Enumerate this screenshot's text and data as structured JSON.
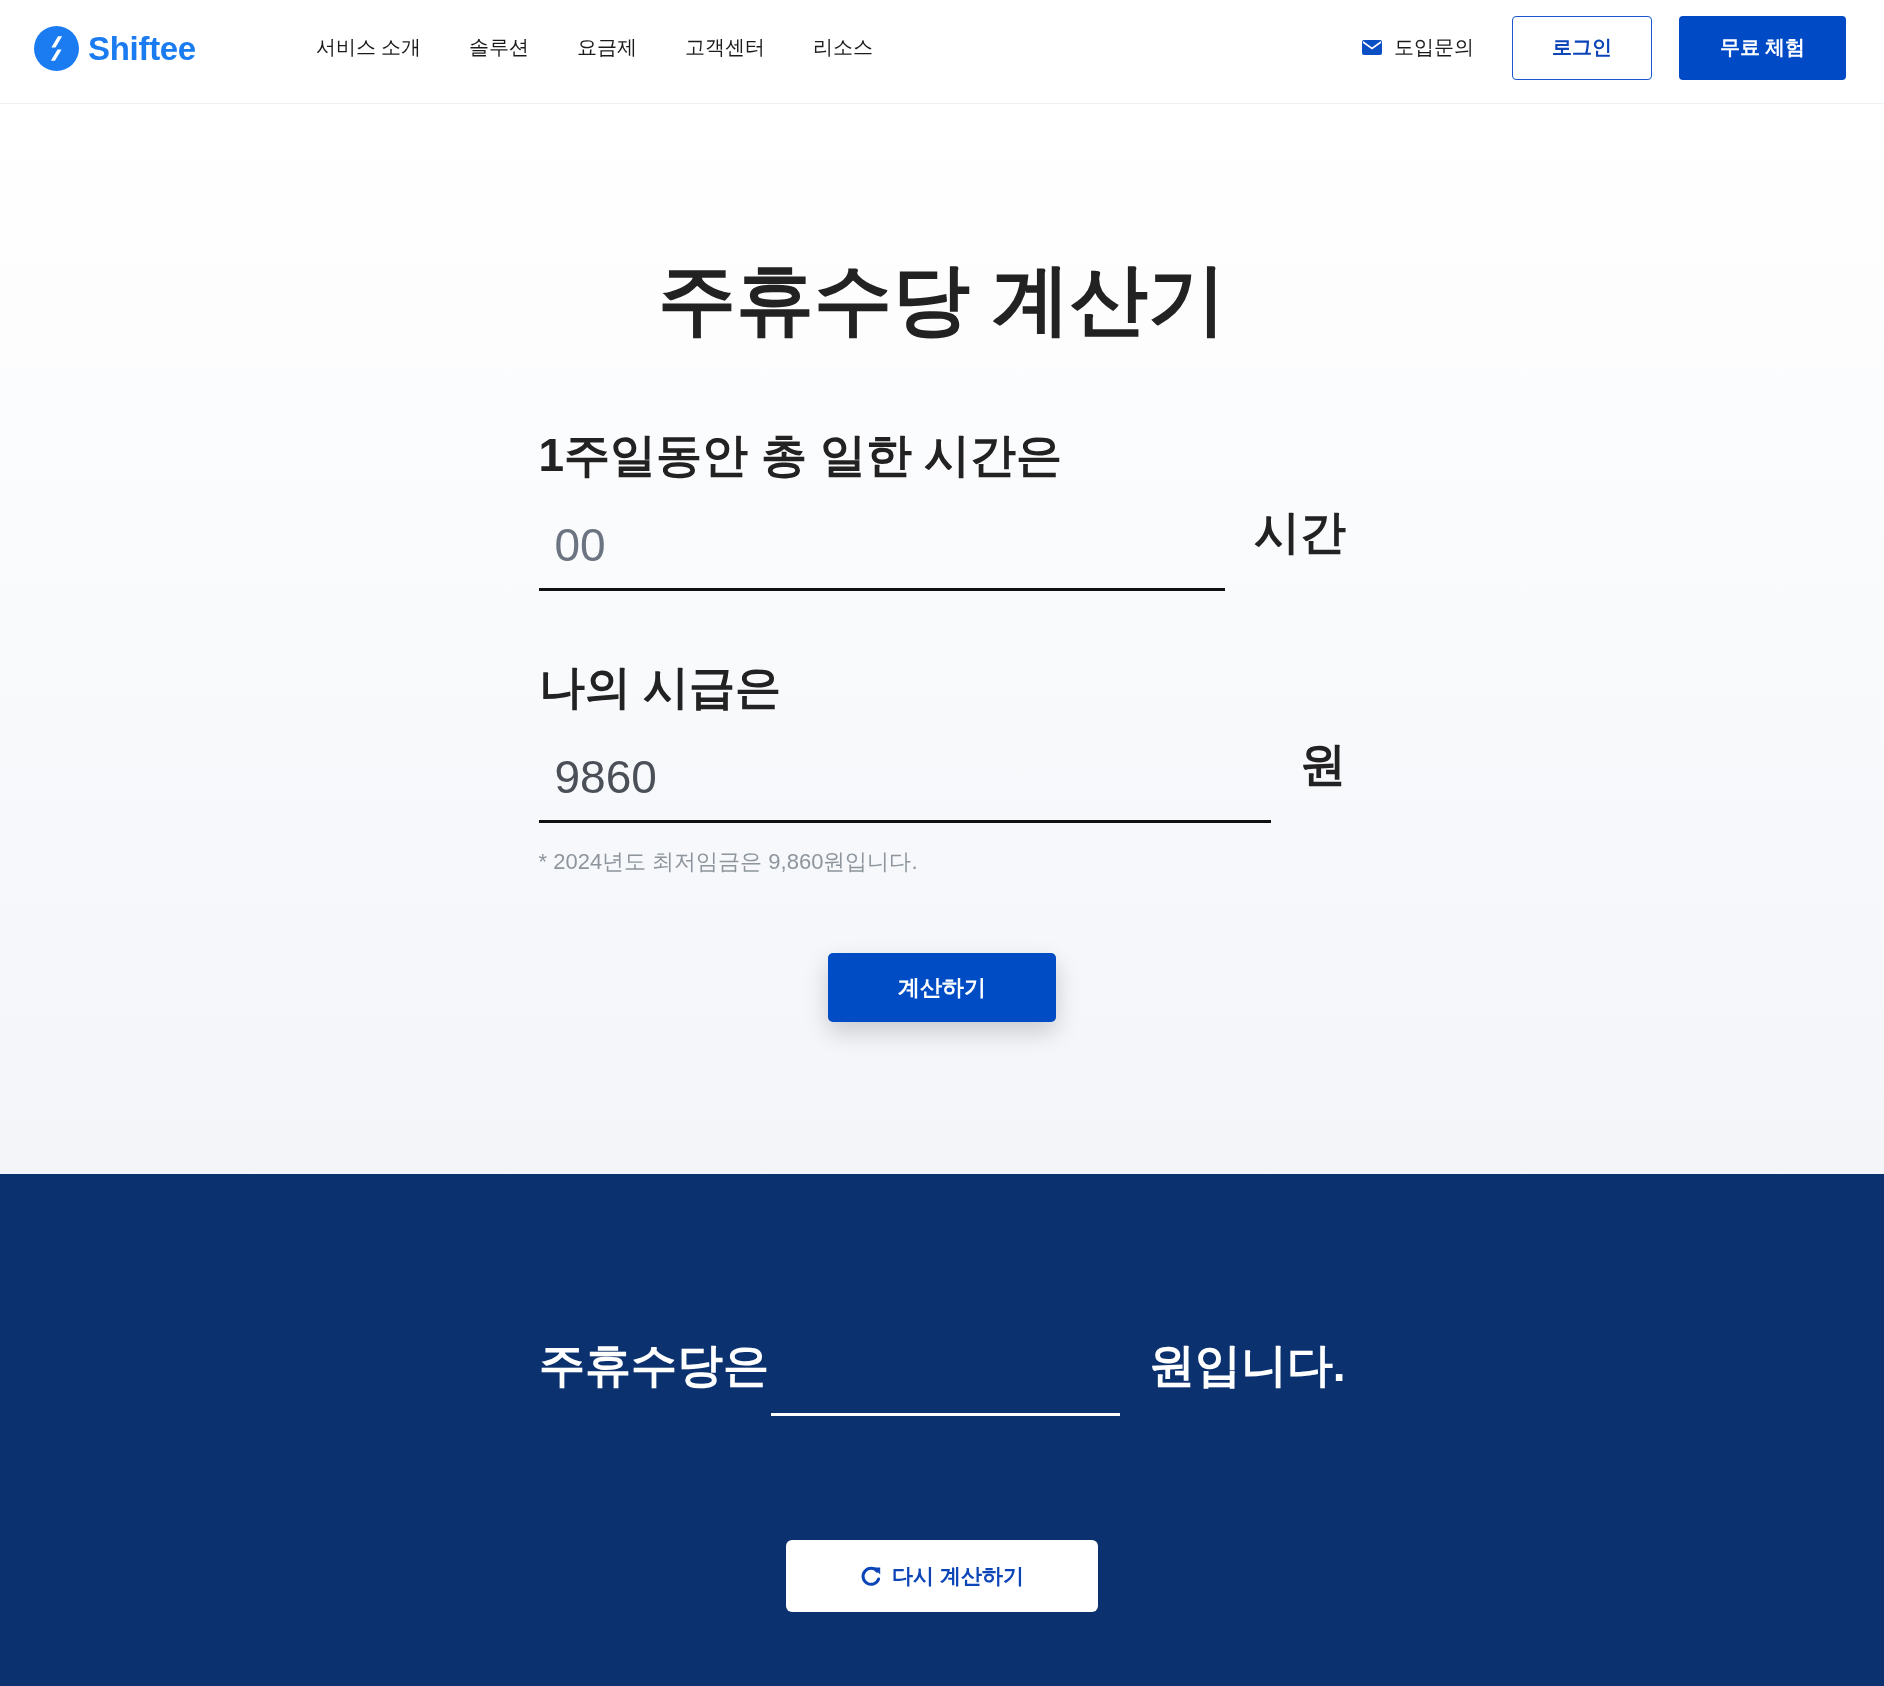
{
  "header": {
    "logo": {
      "text": "Shiftee"
    },
    "nav": [
      {
        "label": "서비스 소개"
      },
      {
        "label": "솔루션"
      },
      {
        "label": "요금제"
      },
      {
        "label": "고객센터"
      },
      {
        "label": "리소스"
      }
    ],
    "contact": {
      "label": "도입문의"
    },
    "buttons": [
      {
        "label": "로그인",
        "kind": "outline"
      },
      {
        "label": "무료 체험",
        "kind": "primary"
      }
    ]
  },
  "calculator": {
    "title": "주휴수당 계산기",
    "fields": [
      {
        "label": "1주일동안 총 일한 시간은",
        "placeholder": "00",
        "unit": "시간"
      },
      {
        "label": "나의 시급은",
        "value": "9860",
        "unit": "원"
      }
    ],
    "note": "* 2024년도 최저임금은 9,860원입니다.",
    "submit": "계산하기"
  },
  "result": {
    "prefix": "주휴수당은",
    "suffix": "원입니다.",
    "reset_button": "다시 계산하기"
  }
}
